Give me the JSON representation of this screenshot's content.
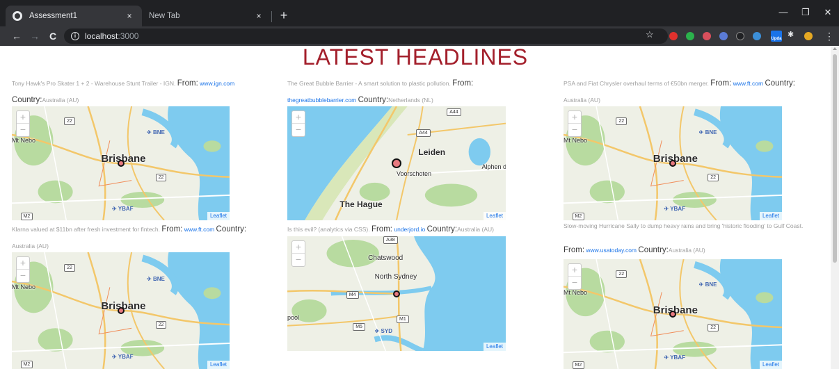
{
  "browser": {
    "tabs": [
      {
        "title": "Assessment1",
        "close": "×"
      },
      {
        "title": "New Tab",
        "close": "×"
      }
    ],
    "new_tab": "+",
    "url_host": "localhost",
    "url_port": ":3000",
    "window_controls": {
      "minimize": "—",
      "maximize": "❐",
      "close": "✕"
    },
    "nav": {
      "back": "←",
      "forward": "→",
      "reload": "C"
    },
    "star": "☆",
    "ext_update_label": "Upda",
    "menu": "⋮"
  },
  "page": {
    "title": "LATEST HEADLINES",
    "from_label": "From:",
    "country_label": "Country:",
    "map_attrib": "Leaflet",
    "articles": [
      {
        "headline": "Tony Hawk's Pro Skater 1 + 2 - Warehouse Stunt Trailer - IGN.",
        "source": "www.ign.com",
        "country": "Australia (AU)",
        "map": "brisbane"
      },
      {
        "headline": "The Great Bubble Barrier - A smart solution to plastic pollution.",
        "source": "thegreatbubblebarrier.com",
        "country": "Netherlands (NL)",
        "map": "leiden"
      },
      {
        "headline": "PSA and Fiat Chrysler overhaul terms of €50bn merger.",
        "source": "www.ft.com",
        "country": "Australia (AU)",
        "map": "brisbane"
      },
      {
        "headline": "Klarna valued at $11bn after fresh investment for fintech.",
        "source": "www.ft.com",
        "country": "Australia (AU)",
        "map": "brisbane"
      },
      {
        "headline": "Is this evil? (analytics via CSS).",
        "source": "underjord.io",
        "country": "Australia (AU)",
        "map": "sydney"
      },
      {
        "headline": "Slow-moving Hurricane Sally to dump heavy rains and bring 'historic flooding' to Gulf Coast.",
        "source": "www.usatoday.com",
        "country": "Australia (AU)",
        "map": "brisbane"
      }
    ]
  },
  "maps": {
    "brisbane": {
      "city": "Brisbane",
      "airport": "BNE",
      "airport2": "YBAF",
      "place": "Mt Nebo",
      "roads": [
        "22",
        "22",
        "M2"
      ]
    },
    "leiden": {
      "city": "Leiden",
      "city2": "The Hague",
      "town": "Voorschoten",
      "town2": "Alphen den R",
      "roads": [
        "A44",
        "A44"
      ]
    },
    "sydney": {
      "city": "North Sydney",
      "town": "Chatswood",
      "airport": "SYD",
      "place": "pool",
      "roads": [
        "A38",
        "M1",
        "M4",
        "M5"
      ]
    }
  },
  "colors": {
    "title": "#a31f2b",
    "link": "#1a73e8",
    "water": "#7ecbef",
    "land": "#eef0e6",
    "park": "#b8dba0",
    "marker": "#e87a80"
  }
}
